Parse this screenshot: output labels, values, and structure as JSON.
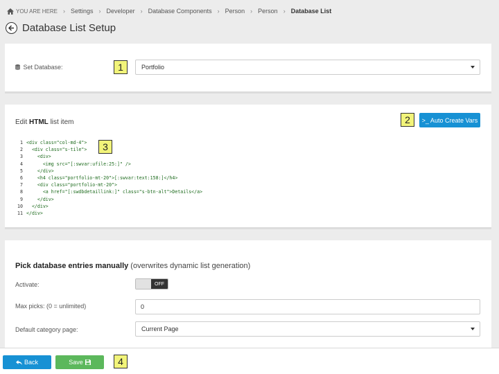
{
  "breadcrumb": {
    "items": [
      "YOU ARE HERE",
      "Settings",
      "Developer",
      "Database Components",
      "Person",
      "Person",
      "Database List"
    ]
  },
  "header": {
    "title": "Database List Setup"
  },
  "set_database": {
    "label": "Set Database:",
    "value": "Portfolio"
  },
  "edit_html": {
    "title_prefix": "Edit ",
    "title_bold": "HTML",
    "title_suffix": " list item",
    "auto_create_label": ">_ Auto Create Vars",
    "code_lines": [
      {
        "n": "1",
        "t": "<div class=\"col-md-4\">"
      },
      {
        "n": "2",
        "t": "  <div class=\"s-tile\">"
      },
      {
        "n": "3",
        "t": "    <div>"
      },
      {
        "n": "4",
        "t": "      <img src=\"[:swvar:ufile:25:]\" />"
      },
      {
        "n": "5",
        "t": "    </div>"
      },
      {
        "n": "6",
        "t": "    <h4 class=\"portfolio-mt-20\">[:swvar:text:158:]</h4>"
      },
      {
        "n": "7",
        "t": "    <div class=\"portfolio-mt-20\">"
      },
      {
        "n": "8",
        "t": "      <a href=\"[:swdbdetaillink:]\" class=\"s-btn-alt\">Details</a>"
      },
      {
        "n": "9",
        "t": "    </div>"
      },
      {
        "n": "10",
        "t": "  </div>"
      },
      {
        "n": "11",
        "t": "</div>"
      }
    ]
  },
  "manual_pick": {
    "title_bold": "Pick database entries manually",
    "title_note": " (overwrites dynamic list generation)",
    "activate_label": "Activate:",
    "toggle_state": "OFF",
    "max_picks_label": "Max picks: (0 = unlimited)",
    "max_picks_value": "0",
    "default_category_label": "Default category page:",
    "default_category_value": "Current Page"
  },
  "footer": {
    "back_label": "Back",
    "save_label": "Save"
  },
  "annotations": [
    "1",
    "2",
    "3",
    "4"
  ],
  "colors": {
    "primary": "#1791d4",
    "success": "#5cb85c",
    "badge": "#f2f47a"
  }
}
